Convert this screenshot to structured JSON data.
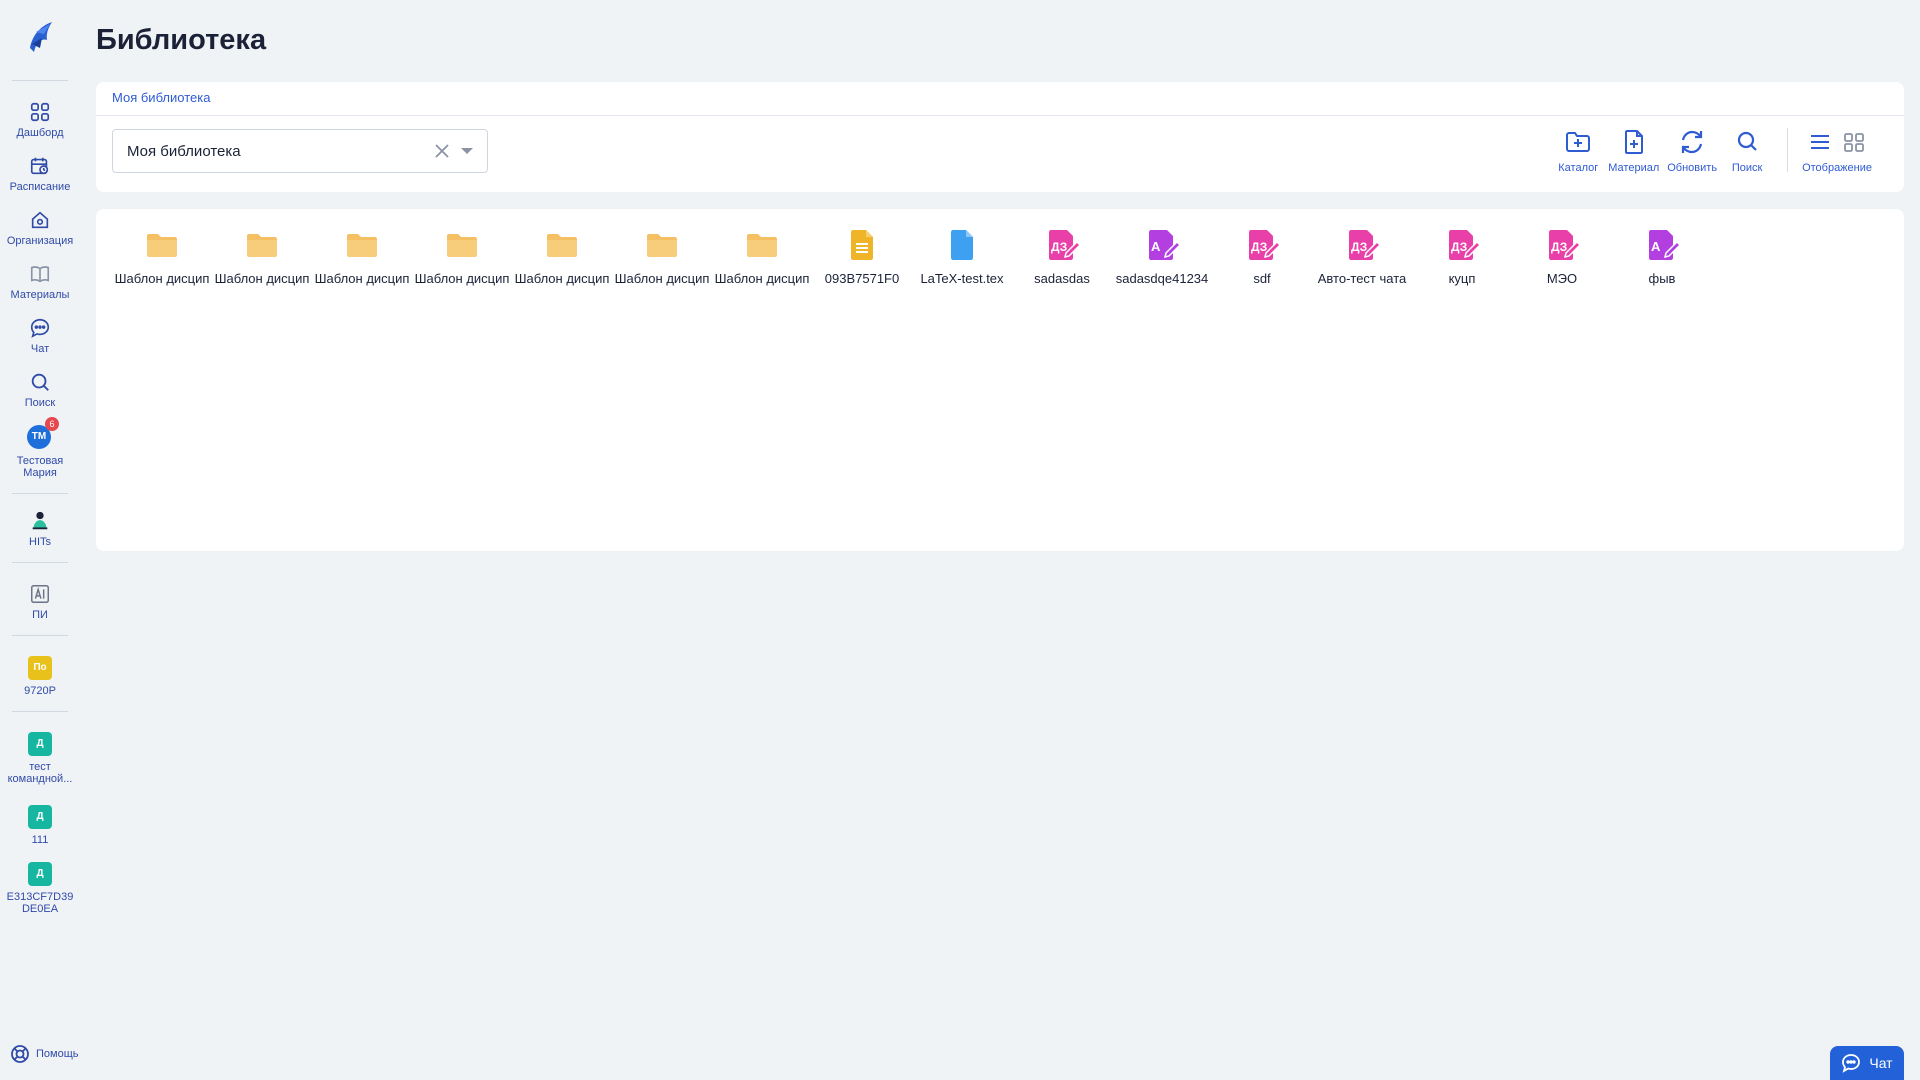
{
  "page": {
    "title": "Библиотека"
  },
  "sidebar": {
    "items": [
      {
        "label": "Дашборд",
        "icon": "dashboard-icon"
      },
      {
        "label": "Расписание",
        "icon": "schedule-icon"
      },
      {
        "label": "Организация",
        "icon": "organization-icon"
      },
      {
        "label": "Материалы",
        "icon": "materials-icon"
      },
      {
        "label": "Чат",
        "icon": "chat-icon"
      },
      {
        "label": "Поиск",
        "icon": "search-icon"
      }
    ],
    "user": {
      "initials": "ТМ",
      "name": "Тестовая Мария",
      "badge": "6"
    },
    "hits": {
      "label": "HITs"
    },
    "pi": {
      "label": "ПИ"
    },
    "groups": [
      {
        "initials": "По",
        "label": "9720Р",
        "color": "#e8c11a"
      },
      {
        "initials": "Д",
        "label": "тест командной...",
        "color": "#17b6a0"
      },
      {
        "initials": "Д",
        "label": "111",
        "color": "#17b6a0"
      },
      {
        "initials": "Д",
        "label": "E313CF7D39DE0EA",
        "color": "#17b6a0"
      }
    ],
    "help": "Помощь"
  },
  "breadcrumb": {
    "item": "Моя библиотека"
  },
  "select": {
    "value": "Моя библиотека"
  },
  "toolbar": {
    "catalog": "Каталог",
    "material": "Материал",
    "refresh": "Обновить",
    "search": "Поиск",
    "view": "Отображение"
  },
  "files": [
    {
      "name": "Шаблон дисцип",
      "type": "folder"
    },
    {
      "name": "Шаблон дисцип",
      "type": "folder"
    },
    {
      "name": "Шаблон дисцип",
      "type": "folder"
    },
    {
      "name": "Шаблон дисцип",
      "type": "folder"
    },
    {
      "name": "Шаблон дисцип",
      "type": "folder"
    },
    {
      "name": "Шаблон дисцип",
      "type": "folder"
    },
    {
      "name": "Шаблон дисцип",
      "type": "folder"
    },
    {
      "name": "093B7571F0",
      "type": "doc"
    },
    {
      "name": "LaTeX-test.tex",
      "type": "file"
    },
    {
      "name": "sadasdas",
      "type": "task-dz"
    },
    {
      "name": "sadasdqe41234",
      "type": "task-a"
    },
    {
      "name": "sdf",
      "type": "task-dz"
    },
    {
      "name": "Авто-тест чата",
      "type": "task-dz"
    },
    {
      "name": "куцп",
      "type": "task-dz"
    },
    {
      "name": "МЭО",
      "type": "task-dz"
    },
    {
      "name": "фыв",
      "type": "task-a"
    }
  ],
  "chat_button": {
    "label": "Чат"
  },
  "colors": {
    "accent": "#2f5bd3",
    "folder": "#f5c063",
    "doc": "#f0b429",
    "file": "#3ea0f0",
    "task": "#e83fa8",
    "task_alt": "#b43fe0"
  }
}
